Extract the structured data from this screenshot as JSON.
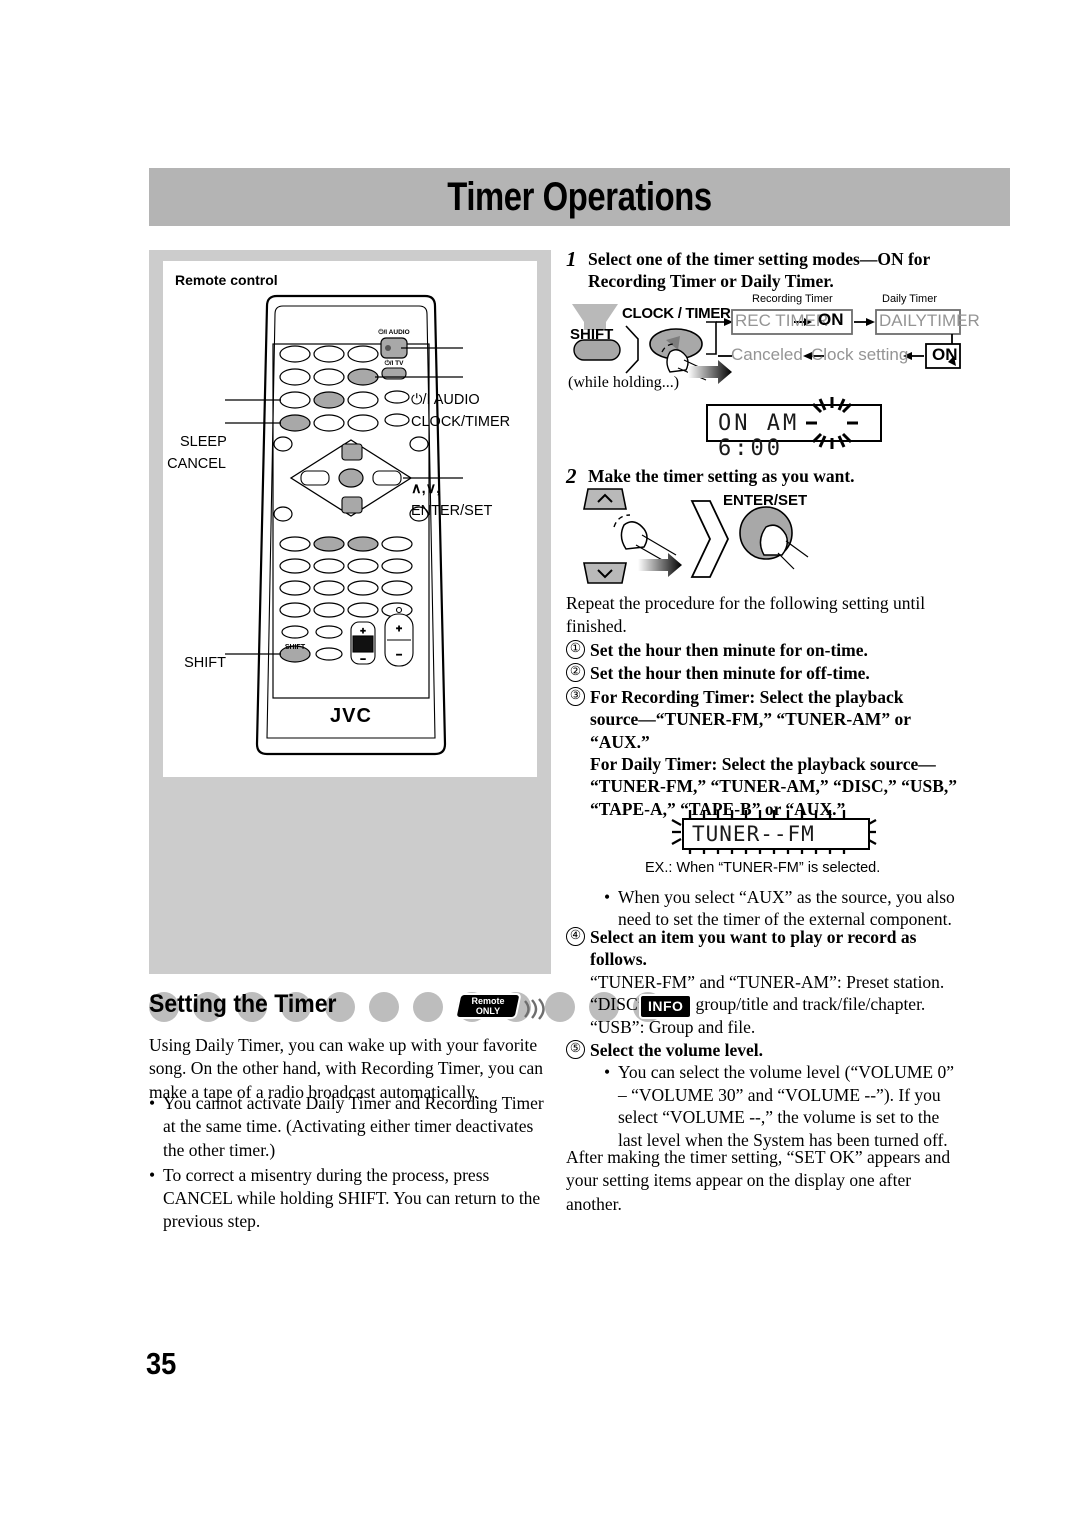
{
  "header": {
    "chapter_title": "Timer Operations"
  },
  "page_number": "35",
  "left": {
    "panel_caption": "Remote control",
    "remote_brand": "JVC",
    "callouts": {
      "power_audio": "⏻/I AUDIO",
      "clock_timer": "CLOCK/TIMER",
      "sleep": "SLEEP",
      "cancel": "CANCEL",
      "updown_line1": "∧,∨,",
      "updown_line2": "ENTER/SET",
      "shift": "SHIFT",
      "power_audio_small": "⏻/I AUDIO",
      "power_tv_small": "⏻/I TV",
      "shift_key_label": "SHIFT"
    },
    "section": {
      "title": "Setting the Timer",
      "badge_remote_line1": "Remote",
      "badge_remote_line2": "ONLY",
      "badge_info": "INFO"
    },
    "lead_paragraph": "Using Daily Timer, you can wake up with your favorite song. On the other hand, with Recording Timer, you can make a tape of a radio broadcast automatically.",
    "bullets": [
      "You cannot activate Daily Timer and Recording Timer at the same time. (Activating either timer deactivates the other timer.)",
      "To correct a misentry during the process, press CANCEL while holding SHIFT. You can return to the previous step."
    ]
  },
  "right": {
    "step1": {
      "number": "1",
      "text": "Select one of the timer setting modes—ON for Recording Timer or Daily Timer."
    },
    "flow": {
      "label_recording_timer": "Recording Timer",
      "label_daily_timer": "Daily Timer",
      "shift_label": "SHIFT",
      "clock_timer_label": "CLOCK / TIMER",
      "while_holding": "(while holding...)",
      "box_rec_timer": "REC TIMER",
      "box_rec_on": "ON",
      "box_daily_timer": "DAILYTIMER",
      "box_daily_on": "ON",
      "box_clock_setting": "Clock setting",
      "box_canceled": "Canceled"
    },
    "lcd_on_time": {
      "segments": "ON  AM 6:00",
      "text_on": "ON",
      "text_am": "AM",
      "text_time": "6:00"
    },
    "step2": {
      "number": "2",
      "text": "Make the timer setting as you want.",
      "enter_set_label": "ENTER/SET"
    },
    "repeat_text": "Repeat the procedure for the following setting until finished.",
    "ordered_items": [
      {
        "num": "①",
        "bold": "Set the hour then minute for on-time.",
        "plain": ""
      },
      {
        "num": "②",
        "bold": "Set the hour then minute for off-time.",
        "plain": ""
      },
      {
        "num": "③",
        "bold": "For Recording Timer: Select the playback source—“TUNER-FM,” “TUNER-AM” or “AUX.” For Daily Timer: Select the playback source— “TUNER-FM,” “TUNER-AM,” “DISC,” “USB,” “TAPE-A,” “TAPE-B” or “AUX.”",
        "plain": ""
      }
    ],
    "item3_line_a": "For Recording Timer: Select the playback",
    "item3_line_b": "source—“TUNER-FM,” “TUNER-AM” or",
    "item3_line_c": "“AUX.”",
    "item3_line_d": "For Daily Timer: Select the playback source—",
    "item3_line_e": "“TUNER-FM,” “TUNER-AM,” “DISC,” “USB,”",
    "item3_line_f": "“TAPE-A,” “TAPE-B” or “AUX.”",
    "lcd_tuner": {
      "text": "TUNER--FM"
    },
    "ex_caption": "EX.: When “TUNER-FM” is selected.",
    "aux_note": "When you select “AUX” as the source, you also need to set the timer of the external component.",
    "item4_bold": "Select an item you want to play or record as follows.",
    "item4_lines": [
      "“TUNER-FM” and “TUNER-AM”: Preset station.",
      "“DISC”: Disc, group/title and track/file/chapter.",
      "“USB”: Group and file."
    ],
    "item4_num": "④",
    "item5_num": "⑤",
    "item5_bold": "Select the volume level.",
    "item5_note": "You can select the volume level (“VOLUME 0” – “VOLUME 30” and “VOLUME --”). If you select “VOLUME --,” the volume is set to the last level when the System has been turned off.",
    "closing": "After making the timer setting, “SET OK” appears and your setting items appear on the display one after another."
  },
  "colors": {
    "header_gray": "#b4b4b4",
    "panel_gray": "#cccccc",
    "button_gray": "#a8a8a8",
    "ghost_gray": "#9a9a9a"
  }
}
